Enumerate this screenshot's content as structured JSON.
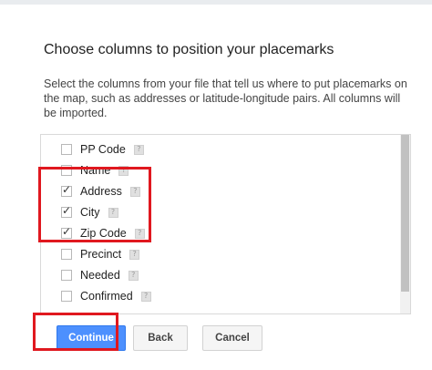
{
  "dialog": {
    "title": "Choose columns to position your placemarks",
    "description": "Select the columns from your file that tell us where to put placemarks on the map, such as addresses or latitude-longitude pairs. All columns will be imported."
  },
  "columns": [
    {
      "label": "PP Code",
      "checked": false,
      "help_icon": "help-icon"
    },
    {
      "label": "Name",
      "checked": false,
      "help_icon": "help-icon"
    },
    {
      "label": "Address",
      "checked": true,
      "help_icon": "help-icon"
    },
    {
      "label": "City",
      "checked": true,
      "help_icon": "help-icon"
    },
    {
      "label": "Zip Code",
      "checked": true,
      "help_icon": "help-icon"
    },
    {
      "label": "Precinct",
      "checked": false,
      "help_icon": "help-icon"
    },
    {
      "label": "Needed",
      "checked": false,
      "help_icon": "help-icon"
    },
    {
      "label": "Confirmed",
      "checked": false,
      "help_icon": "help-icon"
    }
  ],
  "buttons": {
    "continue": "Continue",
    "back": "Back",
    "cancel": "Cancel"
  },
  "help_glyph": "?",
  "colors": {
    "primary_button": "#4d90fe",
    "highlight": "#e0181f"
  }
}
